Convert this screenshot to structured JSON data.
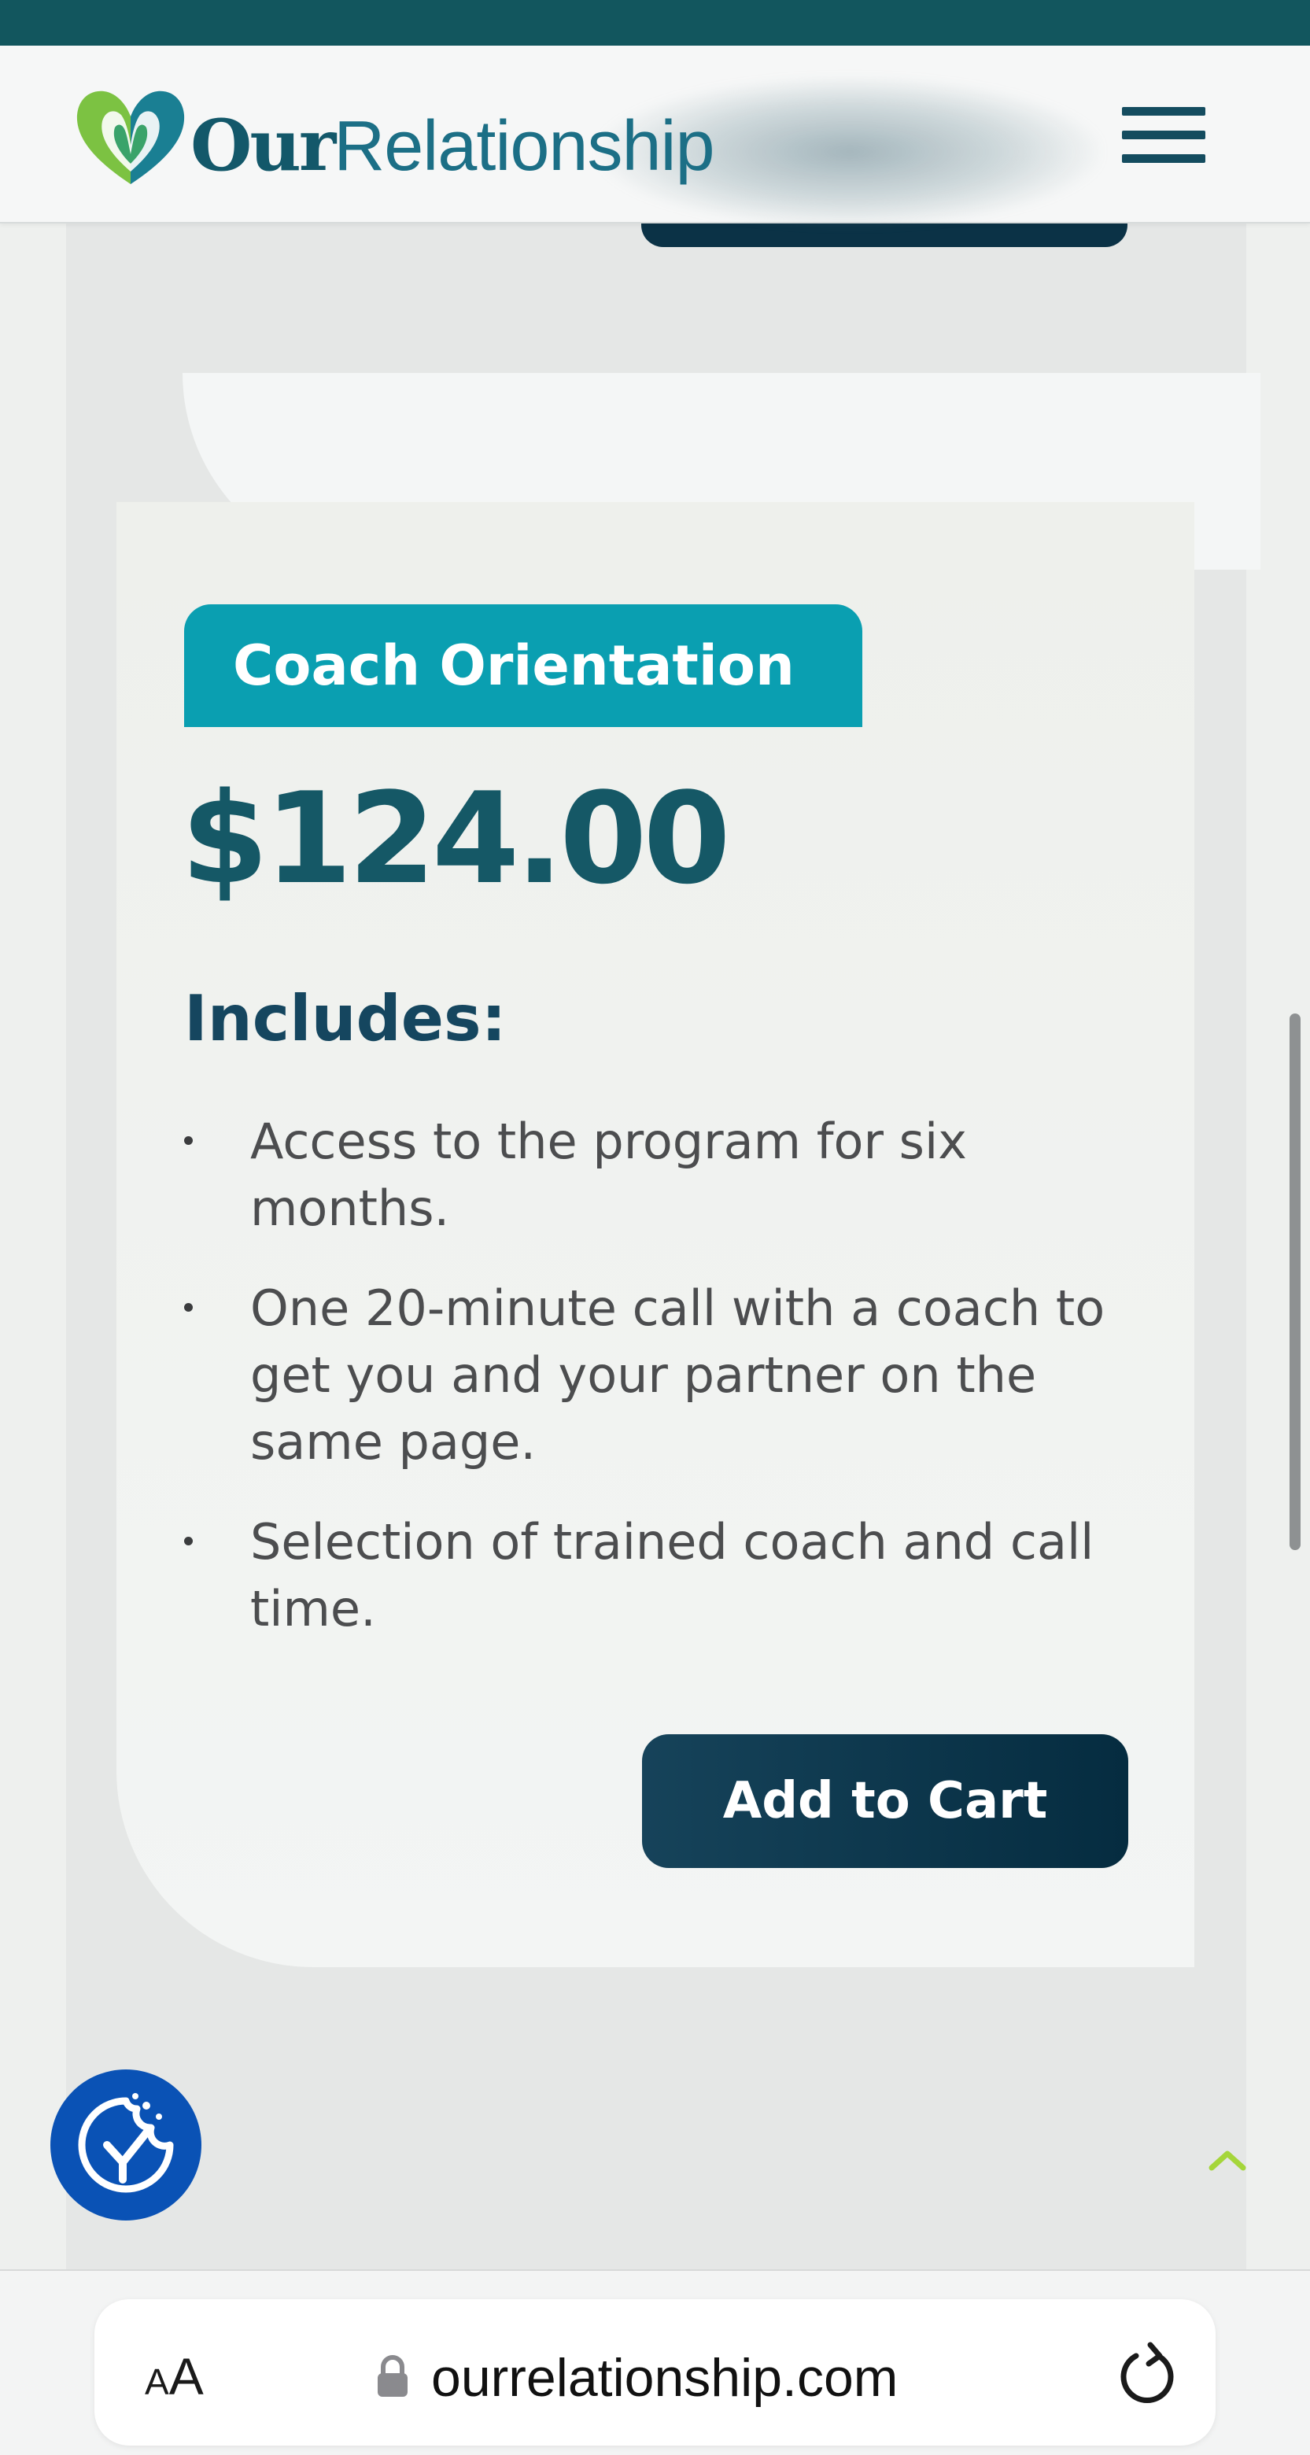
{
  "header": {
    "logo_primary": "Our",
    "logo_secondary": "Relationship",
    "menu_icon": "hamburger-menu-icon"
  },
  "card": {
    "tag": "Coach Orientation",
    "price": "$124.00",
    "includes_heading": "Includes:",
    "features": [
      "Access to the program for six months.",
      "One 20-minute call with a coach to get you and your partner on the same page.",
      "Selection of trained coach and call time."
    ],
    "cta_label": "Add to Cart"
  },
  "floating": {
    "accessibility_icon": "accessibility-cookie-check-icon",
    "back_to_top_icon": "chevron-up-icon"
  },
  "browser": {
    "text_size_small": "A",
    "text_size_large": "A",
    "url": "ourrelationship.com",
    "lock_icon": "lock-icon",
    "reload_icon": "reload-icon"
  },
  "colors": {
    "brand_teal": "#0a9fb1",
    "brand_dark": "#155866",
    "button_navy": "#0b3246",
    "logo_green": "#7cc242",
    "accent_lime": "#a5d63a",
    "top_strip": "#12565e"
  }
}
